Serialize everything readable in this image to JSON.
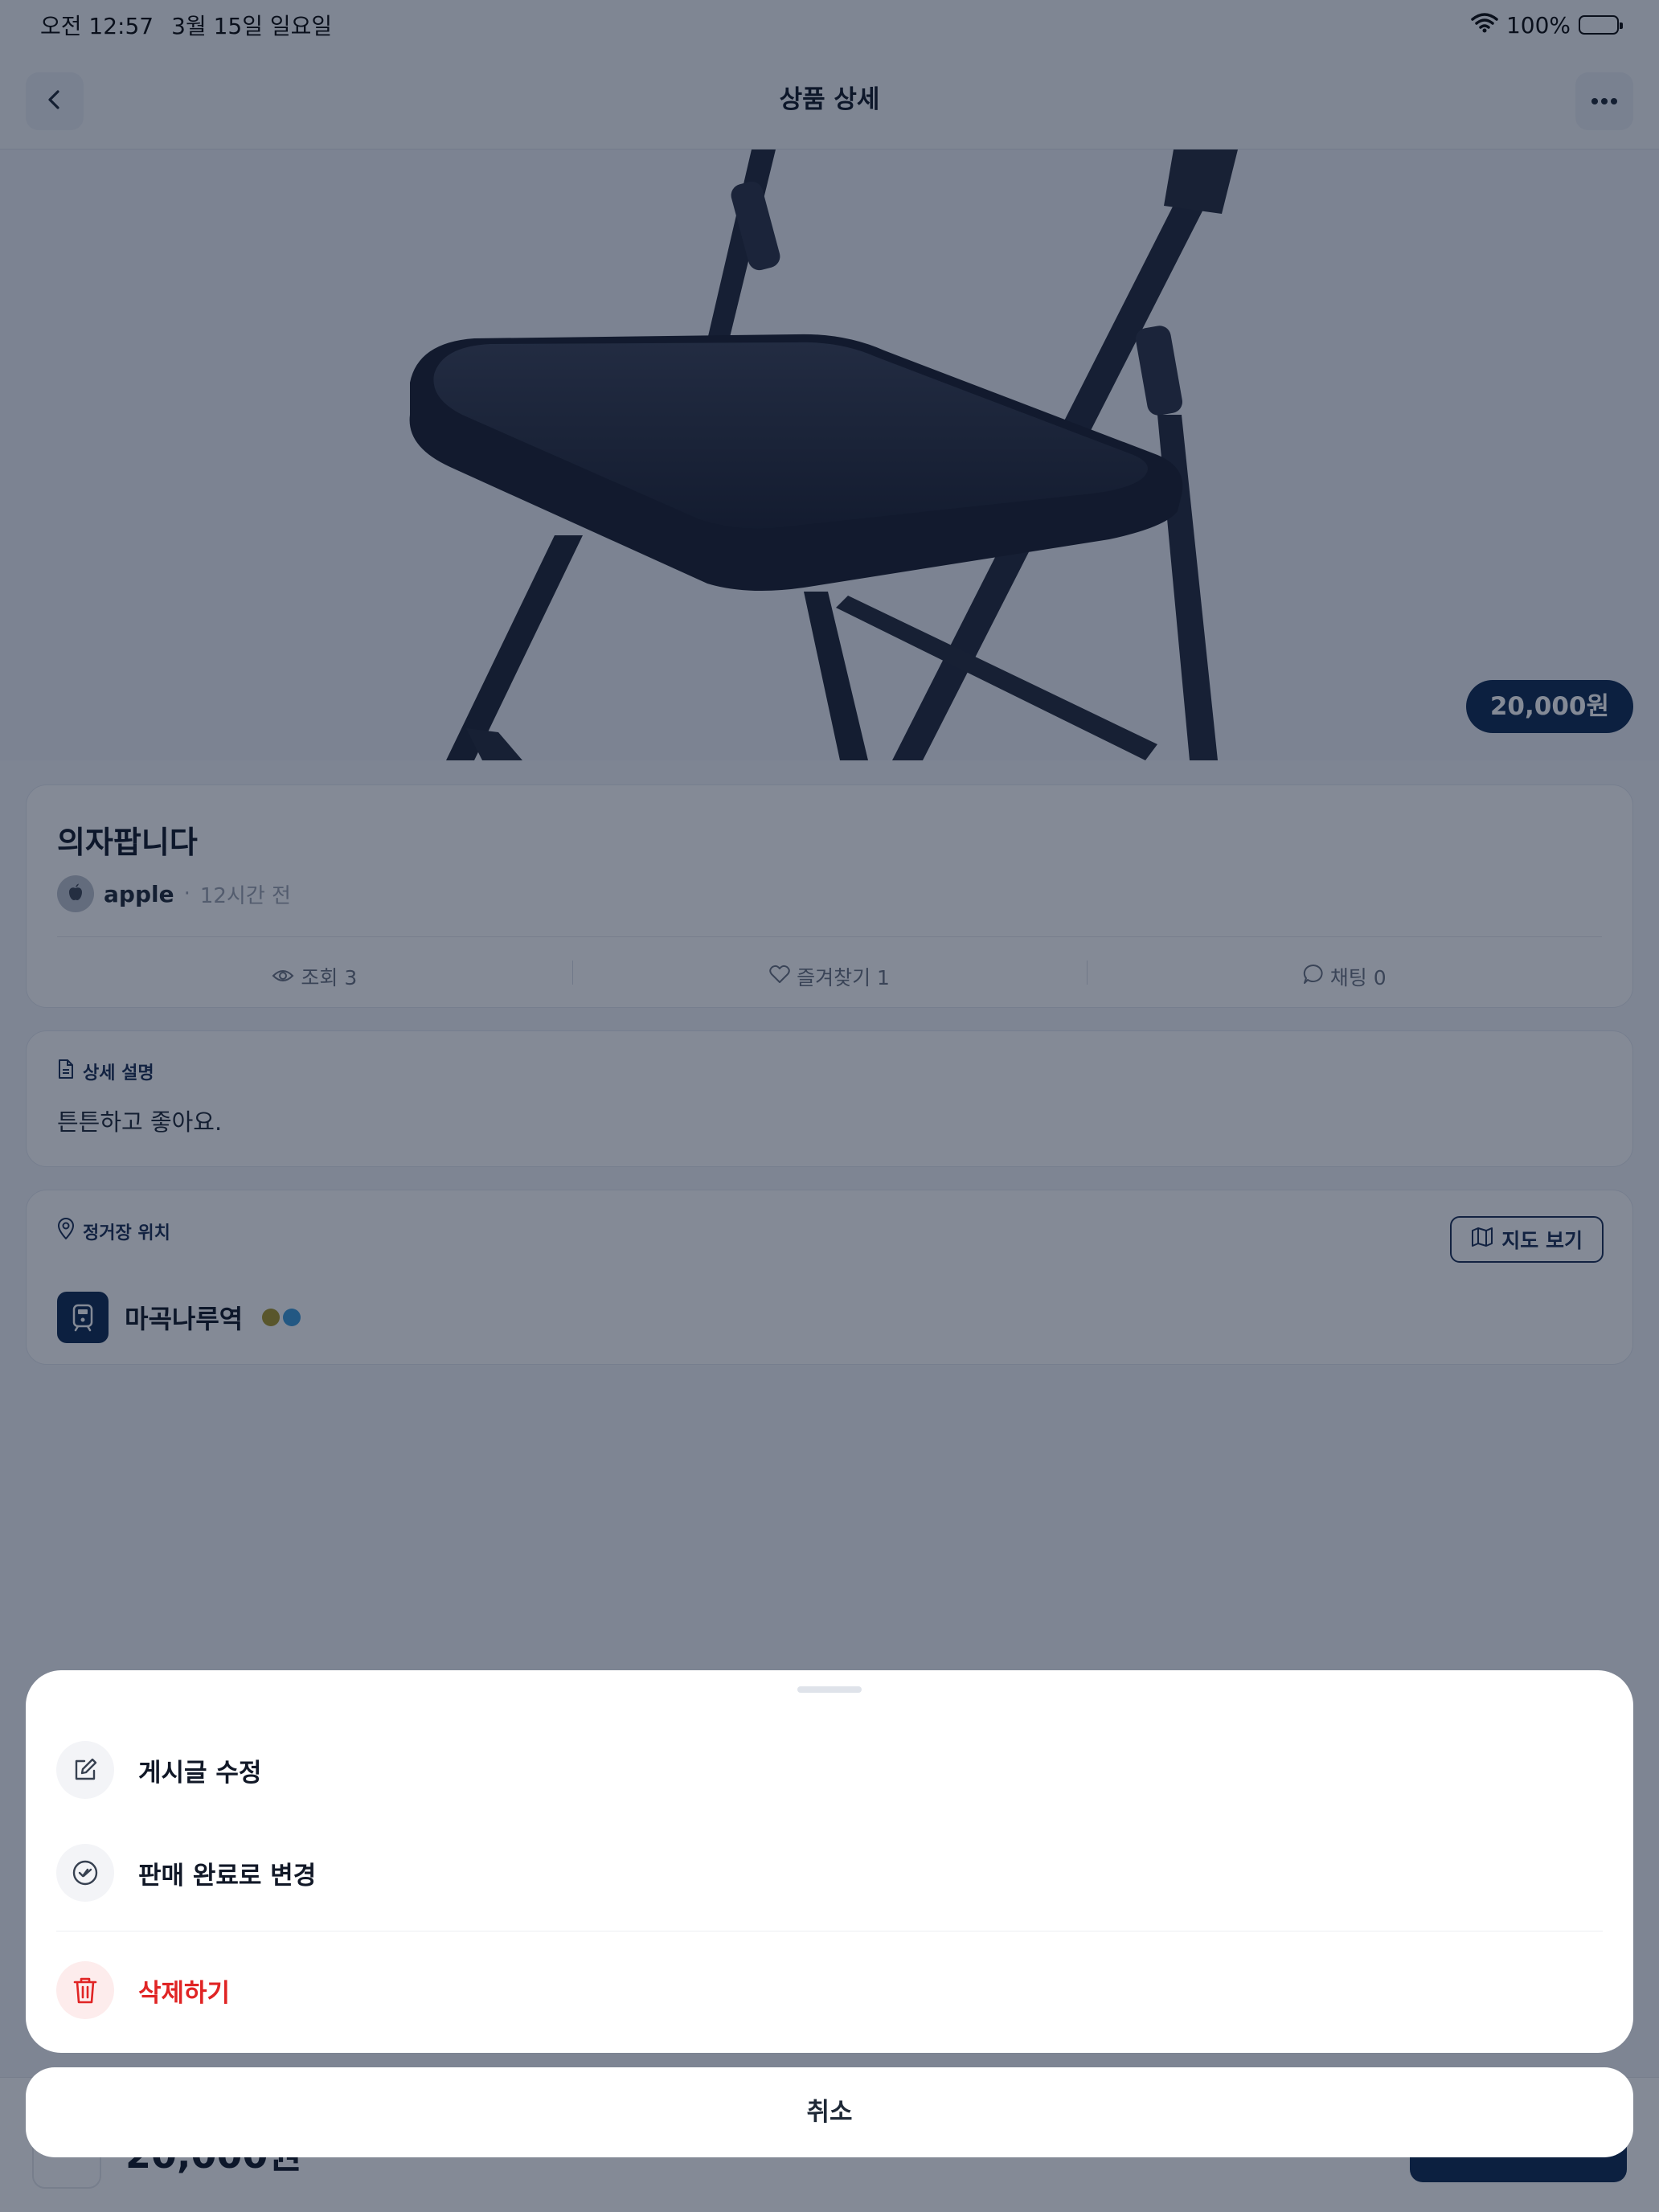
{
  "status_bar": {
    "time": "오전 12:57",
    "date": "3월 15일 일요일",
    "battery": "100%"
  },
  "nav": {
    "title": "상품 상세",
    "back_icon": "chevron-left-icon",
    "more_icon": "more-horizontal-icon"
  },
  "product": {
    "price_badge": "20,000원",
    "title": "의자팝니다",
    "author": "apple",
    "separator": "·",
    "time_ago": "12시간 전",
    "stats": {
      "views": "조회 3",
      "favorites": "즐겨찾기 1",
      "chats": "채팅 0"
    }
  },
  "description": {
    "label": "상세 설명",
    "text": "튼튼하고 좋아요."
  },
  "location": {
    "label": "정거장 위치",
    "map_button": "지도 보기",
    "station": "마곡나루역",
    "line_colors": [
      "#a9972a",
      "#3d9bd8"
    ]
  },
  "bottom_bar": {
    "price": "20,000원"
  },
  "action_sheet": {
    "items": [
      {
        "label": "게시글 수정",
        "icon": "edit-icon"
      },
      {
        "label": "판매 완료로 변경",
        "icon": "check-circle-icon"
      },
      {
        "label": "삭제하기",
        "icon": "trash-icon"
      }
    ],
    "cancel": "취소"
  },
  "colors": {
    "brand": "#0f2a52",
    "danger": "#e02424",
    "overlay": "rgba(10,22,45,0.5)"
  }
}
